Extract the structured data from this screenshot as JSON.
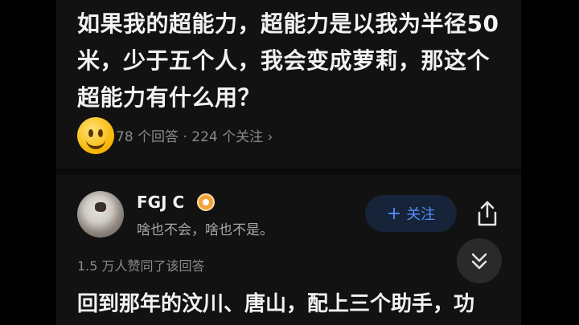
{
  "question": {
    "title": "如果我的超能力，超能力是以我为半径50米，少于五个人，我会变成萝莉，那这个超能力有什么用？",
    "meta": "78 个回答 · 224 个关注 ›"
  },
  "answer": {
    "author": "FGJ C",
    "bio": "啥也不会，啥也不是。",
    "follow_label": "关注",
    "follow_icon": "+",
    "likes": "1.5 万人赞同了该回答",
    "text": "回到那年的汶川、唐山，配上三个助手，功"
  },
  "colors": {
    "accent": "#4f8ef7",
    "badge": "#f3a23a"
  }
}
